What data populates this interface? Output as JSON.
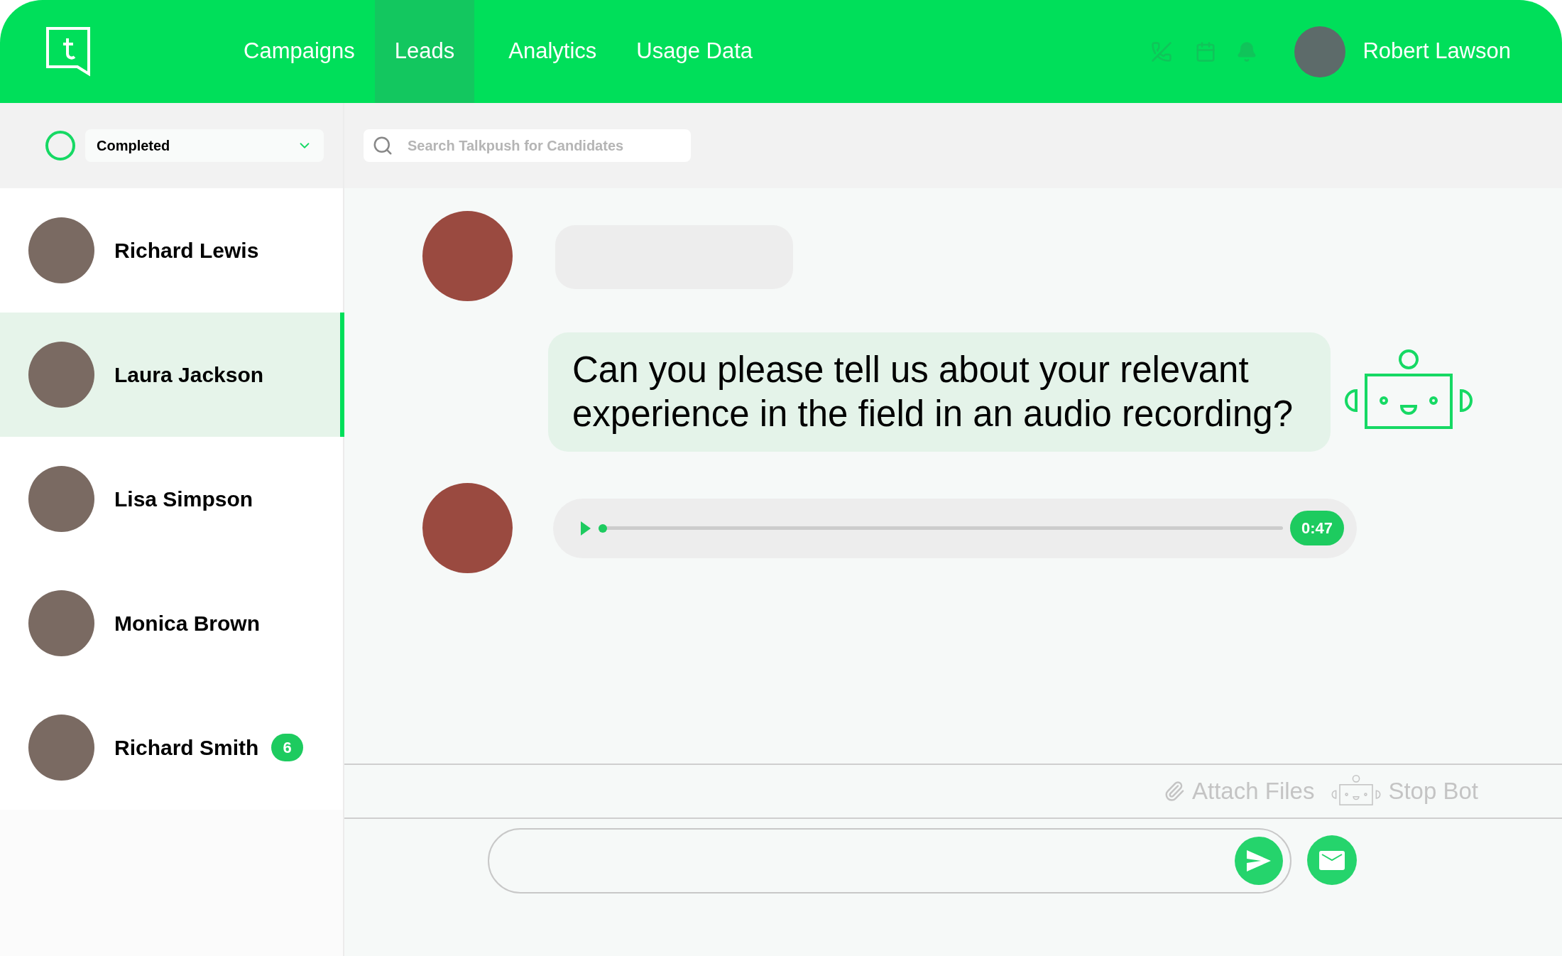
{
  "nav": [
    {
      "label": "Campaigns",
      "selected": false
    },
    {
      "label": "Leads",
      "selected": true
    },
    {
      "label": "Analytics",
      "selected": false
    },
    {
      "label": "Usage Data",
      "selected": false
    }
  ],
  "user": {
    "name": "Robert Lawson"
  },
  "filter": {
    "value": "Completed"
  },
  "search": {
    "placeholder": "Search Talkpush for Candidates"
  },
  "leads": [
    {
      "name": "Richard Lewis",
      "selected": false
    },
    {
      "name": "Laura Jackson",
      "selected": true
    },
    {
      "name": "Lisa Simpson",
      "selected": false
    },
    {
      "name": "Monica Brown",
      "selected": false
    },
    {
      "name": "Richard Smith",
      "selected": false,
      "badge": "6"
    }
  ],
  "messages": [
    {
      "kind": "candidate-empty"
    },
    {
      "kind": "bot-text",
      "text": "Can you please tell us about your relevant experience in the field in an audio recording?"
    },
    {
      "kind": "audio",
      "level": 0,
      "duration": "0:47"
    }
  ],
  "actions": [
    {
      "kind": "attach",
      "label": "Attach Files"
    },
    {
      "kind": "bot",
      "label": "Stop Bot"
    }
  ]
}
